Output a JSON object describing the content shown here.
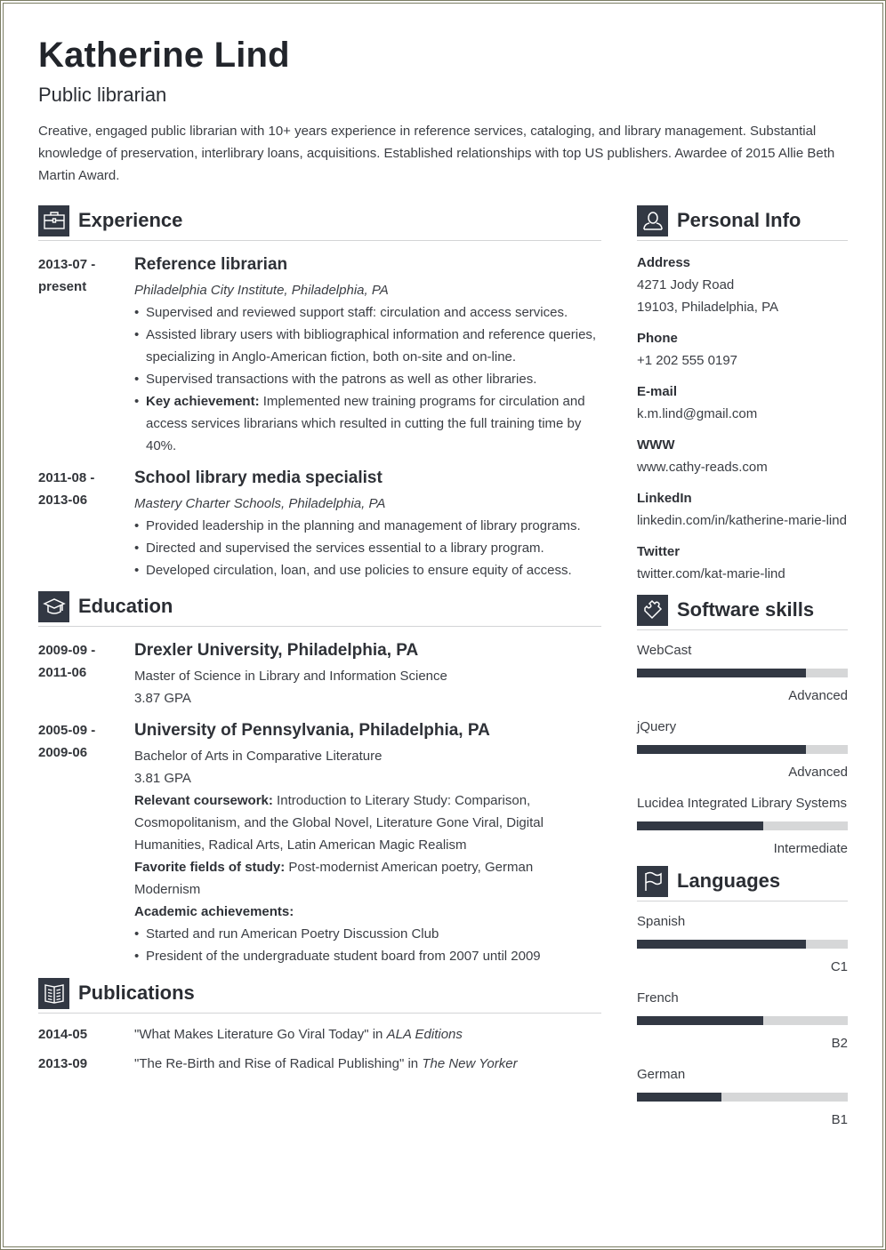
{
  "header": {
    "name": "Katherine Lind",
    "title": "Public librarian",
    "summary": "Creative, engaged public librarian with 10+ years experience in reference services, cataloging, and library management. Substantial knowledge of preservation, interlibrary loans, acquisitions. Established relationships with top US publishers. Awardee of 2015 Allie Beth Martin Award."
  },
  "experience": {
    "heading": "Experience",
    "icon": "briefcase-icon",
    "items": [
      {
        "date_start": "2013-07 -",
        "date_end": "present",
        "title": "Reference librarian",
        "org": "Philadelphia City Institute, Philadelphia, PA",
        "bullets": [
          {
            "bold": "",
            "text": "Supervised and reviewed support staff: circulation and access services."
          },
          {
            "bold": "",
            "text": "Assisted library users with bibliographical information and reference queries, specializing in Anglo-American fiction, both on-site and on-line."
          },
          {
            "bold": "",
            "text": "Supervised transactions with the patrons as well as other libraries."
          },
          {
            "bold": "Key achievement:",
            "text": " Implemented new training programs for circulation and access services librarians which resulted in cutting the full training time by 40%."
          }
        ]
      },
      {
        "date_start": "2011-08 -",
        "date_end": "2013-06",
        "title": "School library media specialist",
        "org": "Mastery Charter Schools, Philadelphia, PA",
        "bullets": [
          {
            "bold": "",
            "text": "Provided leadership in the planning and management of library programs."
          },
          {
            "bold": "",
            "text": "Directed and supervised the services essential to a library program."
          },
          {
            "bold": "",
            "text": "Developed circulation, loan, and use policies to ensure equity of access."
          }
        ]
      }
    ]
  },
  "education": {
    "heading": "Education",
    "icon": "graduation-cap-icon",
    "items": [
      {
        "date_start": "2009-09 -",
        "date_end": "2011-06",
        "school": "Drexler University, Philadelphia, PA",
        "degree": "Master of Science in Library and Information Science",
        "gpa": "3.87 GPA"
      },
      {
        "date_start": "2005-09 -",
        "date_end": "2009-06",
        "school": "University of Pennsylvania, Philadelphia, PA",
        "degree": "Bachelor of Arts in Comparative Literature",
        "gpa": "3.81 GPA",
        "coursework_label": "Relevant coursework:",
        "coursework": " Introduction to Literary Study: Comparison, Cosmopolitanism, and the Global Novel, Literature Gone Viral, Digital Humanities, Radical Arts, Latin American Magic Realism",
        "fields_label": "Favorite fields of study:",
        "fields": " Post-modernist American poetry, German Modernism",
        "achievements_label": "Academic achievements:",
        "achievements": [
          "Started and run American Poetry Discussion Club",
          "President of the undergraduate student board from 2007 until 2009"
        ]
      }
    ]
  },
  "publications": {
    "heading": "Publications",
    "icon": "book-icon",
    "items": [
      {
        "date": "2014-05",
        "title": "\"What Makes Literature Go Viral Today\" in ",
        "venue": "ALA Editions"
      },
      {
        "date": "2013-09",
        "title": "\"The Re-Birth and Rise of Radical Publishing\" in ",
        "venue": "The New Yorker"
      }
    ]
  },
  "personal_info": {
    "heading": "Personal Info",
    "icon": "user-icon",
    "address_label": "Address",
    "address_line1": "4271 Jody Road",
    "address_line2": "19103, Philadelphia, PA",
    "phone_label": "Phone",
    "phone": "+1 202 555 0197",
    "email_label": "E-mail",
    "email": "k.m.lind@gmail.com",
    "www_label": "WWW",
    "www": "www.cathy-reads.com",
    "linkedin_label": "LinkedIn",
    "linkedin": "linkedin.com/in/katherine-marie-lind",
    "twitter_label": "Twitter",
    "twitter": "twitter.com/kat-marie-lind"
  },
  "software_skills": {
    "heading": "Software skills",
    "icon": "puzzle-icon",
    "items": [
      {
        "name": "WebCast",
        "level": "Advanced",
        "fill": 0.8
      },
      {
        "name": "jQuery",
        "level": "Advanced",
        "fill": 0.8
      },
      {
        "name": "Lucidea Integrated Library Systems",
        "level": "Intermediate",
        "fill": 0.6
      }
    ]
  },
  "languages": {
    "heading": "Languages",
    "icon": "flag-icon",
    "items": [
      {
        "name": "Spanish",
        "level": "C1",
        "fill": 0.8
      },
      {
        "name": "French",
        "level": "B2",
        "fill": 0.6
      },
      {
        "name": "German",
        "level": "B1",
        "fill": 0.4
      }
    ]
  },
  "colors": {
    "accent": "#323843",
    "bar_track": "#d6d7d8",
    "text": "#33363b",
    "frame": "#7a7c62"
  }
}
